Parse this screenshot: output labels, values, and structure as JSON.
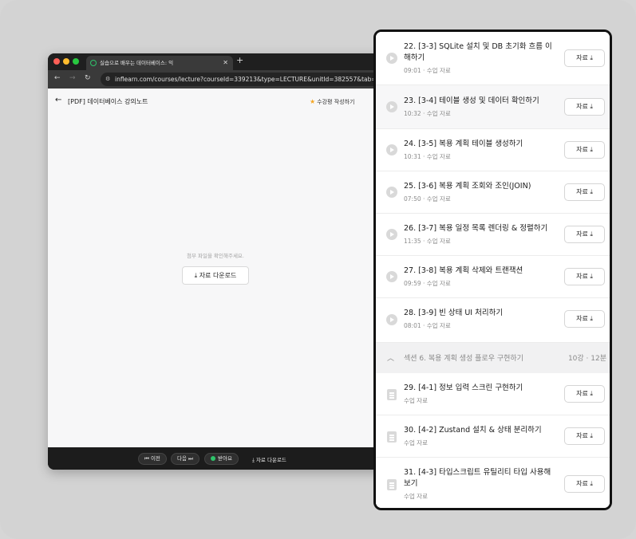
{
  "browser": {
    "tab_title": "실습으로 배우는 데이터베이스: 익",
    "url": "inflearn.com/courses/lecture?courseId=339213&type=LECTURE&unitId=382557&tab=curri",
    "page_title": "[PDF] 데이터베이스 강의노트",
    "review_label": "수강평 작성하기",
    "empty_message": "첨부 파일을 확인해주세요.",
    "download_label": "자료 다운로드",
    "bottom": {
      "prev": "이전",
      "next": "다음",
      "status": "받아요",
      "download": "자료 다운로드"
    }
  },
  "curriculum": {
    "resource_label": "자료",
    "items": [
      {
        "title": "22. [3-3] SQLite 설치 및 DB 초기화 흐름 이해하기",
        "meta": "09:01 · 수업 자료",
        "kind": "video"
      },
      {
        "title": "23. [3-4] 테이블 생성 및 데이터 확인하기",
        "meta": "10:32 · 수업 자료",
        "kind": "video"
      },
      {
        "title": "24. [3-5] 복용 계획 테이블 생성하기",
        "meta": "10:31 · 수업 자료",
        "kind": "video"
      },
      {
        "title": "25. [3-6] 복용 계획 조회와 조인(JOIN)",
        "meta": "07:50 · 수업 자료",
        "kind": "video"
      },
      {
        "title": "26. [3-7] 복용 일정 목록 렌더링 & 정렬하기",
        "meta": "11:35 · 수업 자료",
        "kind": "video"
      },
      {
        "title": "27. [3-8] 복용 계획 삭제와 트랜잭션",
        "meta": "09:59 · 수업 자료",
        "kind": "video"
      },
      {
        "title": "28. [3-9] 빈 상태 UI 처리하기",
        "meta": "08:01 · 수업 자료",
        "kind": "video"
      }
    ],
    "section": {
      "title": "섹션 6. 복용 계획 생성 플로우 구현하기",
      "count": "10강 · 12분"
    },
    "items2": [
      {
        "title": "29. [4-1] 정보 입력 스크린 구현하기",
        "meta": "수업 자료",
        "kind": "doc"
      },
      {
        "title": "30. [4-2] Zustand 설치 & 상태 분리하기",
        "meta": "수업 자료",
        "kind": "doc"
      },
      {
        "title": "31. [4-3] 타입스크립트 유틸리티 타입 사용해 보기",
        "meta": "수업 자료",
        "kind": "doc"
      }
    ]
  }
}
